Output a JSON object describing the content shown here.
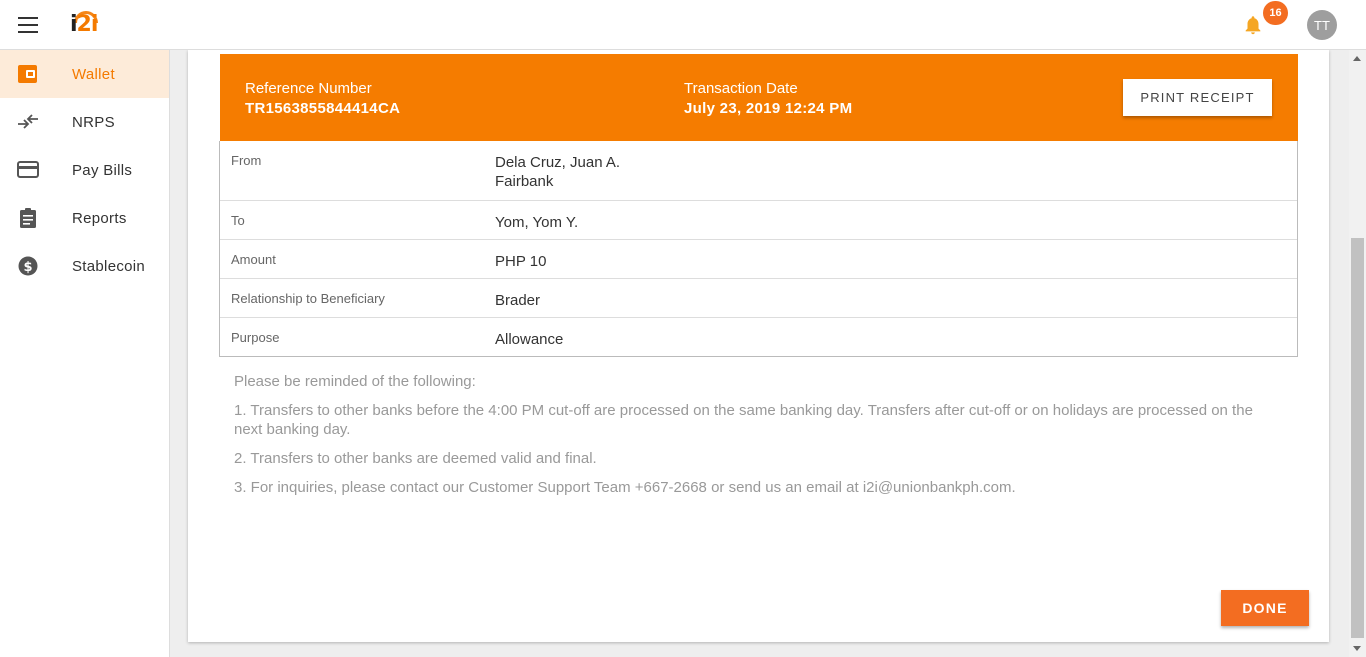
{
  "app": {
    "logo_i": "i",
    "logo_2i": "2i",
    "notification_count": "16",
    "avatar_initials": "TT"
  },
  "colors": {
    "brand_orange": "#f57c00",
    "accent": "#f36d21",
    "active_nav_bg": "#fdebd9"
  },
  "sidebar": {
    "items": [
      {
        "label": "Wallet",
        "icon": "wallet-icon",
        "active": true
      },
      {
        "label": "NRPS",
        "icon": "transfer-arrows-icon",
        "active": false
      },
      {
        "label": "Pay Bills",
        "icon": "credit-card-icon",
        "active": false
      },
      {
        "label": "Reports",
        "icon": "clipboard-icon",
        "active": false
      },
      {
        "label": "Stablecoin",
        "icon": "dollar-coin-icon",
        "active": false
      }
    ]
  },
  "receipt": {
    "reference_label": "Reference Number",
    "reference_value": "TR1563855844414CA",
    "date_label": "Transaction Date",
    "date_value": "July 23, 2019 12:24 PM",
    "print_label": "PRINT RECEIPT",
    "rows": [
      {
        "key": "From",
        "value_line1": "Dela Cruz, Juan A.",
        "value_line2": "Fairbank"
      },
      {
        "key": "To",
        "value": "Yom, Yom Y."
      },
      {
        "key": "Amount",
        "value": "PHP 10"
      },
      {
        "key": "Relationship to Beneficiary",
        "value": "Brader"
      },
      {
        "key": "Purpose",
        "value": "Allowance"
      }
    ]
  },
  "notes": {
    "intro": "Please be reminded of the following:",
    "items": [
      "1. Transfers to other banks before the 4:00 PM cut-off are processed on the same banking day. Transfers after cut-off or on holidays are processed on the next banking day.",
      "2. Transfers to other banks are deemed valid and final.",
      "3. For inquiries, please contact our Customer Support Team +667-2668 or send us an email at i2i@unionbankph.com."
    ]
  },
  "actions": {
    "done_label": "DONE"
  }
}
